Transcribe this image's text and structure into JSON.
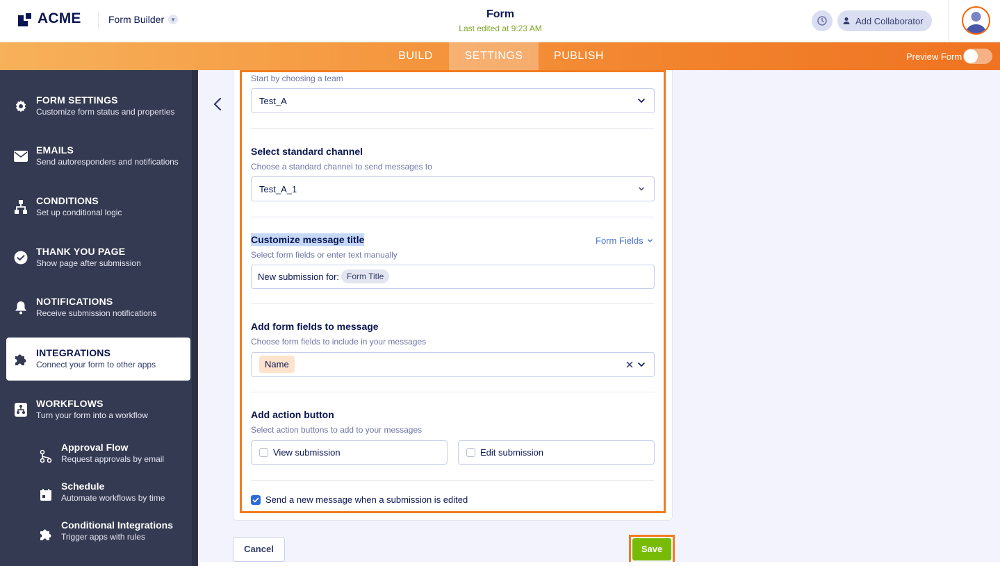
{
  "header": {
    "logo_text": "ACME",
    "app_name": "Form Builder",
    "form_title": "Form",
    "last_edited": "Last edited at 9:23 AM",
    "add_collaborator_label": "Add Collaborator"
  },
  "tabs": {
    "build": "BUILD",
    "settings": "SETTINGS",
    "publish": "PUBLISH",
    "active": "SETTINGS",
    "preview_label": "Preview Form",
    "preview_enabled": false
  },
  "sidebar": {
    "items": [
      {
        "title": "FORM SETTINGS",
        "desc": "Customize form status and properties",
        "icon": "gear-icon"
      },
      {
        "title": "EMAILS",
        "desc": "Send autoresponders and notifications",
        "icon": "envelope-icon"
      },
      {
        "title": "CONDITIONS",
        "desc": "Set up conditional logic",
        "icon": "hierarchy-icon"
      },
      {
        "title": "THANK YOU PAGE",
        "desc": "Show page after submission",
        "icon": "check-circle-icon"
      },
      {
        "title": "NOTIFICATIONS",
        "desc": "Receive submission notifications",
        "icon": "bell-icon"
      },
      {
        "title": "INTEGRATIONS",
        "desc": "Connect your form to other apps",
        "icon": "puzzle-icon"
      },
      {
        "title": "WORKFLOWS",
        "desc": "Turn your form into a workflow",
        "icon": "workflow-icon"
      }
    ],
    "sub_items": [
      {
        "title": "Approval Flow",
        "desc": "Request approvals by email",
        "icon": "approval-flow-icon"
      },
      {
        "title": "Schedule",
        "desc": "Automate workflows by time",
        "icon": "calendar-icon"
      },
      {
        "title": "Conditional Integrations",
        "desc": "Trigger apps with rules",
        "icon": "puzzle-icon"
      }
    ]
  },
  "integration": {
    "team_hint": "Start by choosing a team",
    "team_value": "Test_A",
    "channel_title": "Select standard channel",
    "channel_hint": "Choose a standard channel to send messages to",
    "channel_value": "Test_A_1",
    "msg_title_label": "Customize message title",
    "form_fields_link": "Form Fields",
    "msg_title_hint": "Select form fields or enter text manually",
    "msg_title_prefix": "New submission for:",
    "msg_title_chip": "Form Title",
    "fields_title": "Add form fields to message",
    "fields_hint": "Choose form fields to include in your messages",
    "fields_chip": "Name",
    "action_title": "Add action button",
    "action_hint": "Select action buttons to add to your messages",
    "view_submission": "View submission",
    "view_checked": false,
    "edit_submission": "Edit submission",
    "edit_checked": false,
    "resend_label": "Send a new message when a submission is edited",
    "resend_checked": true
  },
  "footer": {
    "cancel_label": "Cancel",
    "save_label": "Save"
  },
  "colors": {
    "accent_orange": "#f37b1d",
    "save_green": "#78bb07",
    "sidebar_bg": "#343a51",
    "link_blue": "#4c73d1"
  }
}
